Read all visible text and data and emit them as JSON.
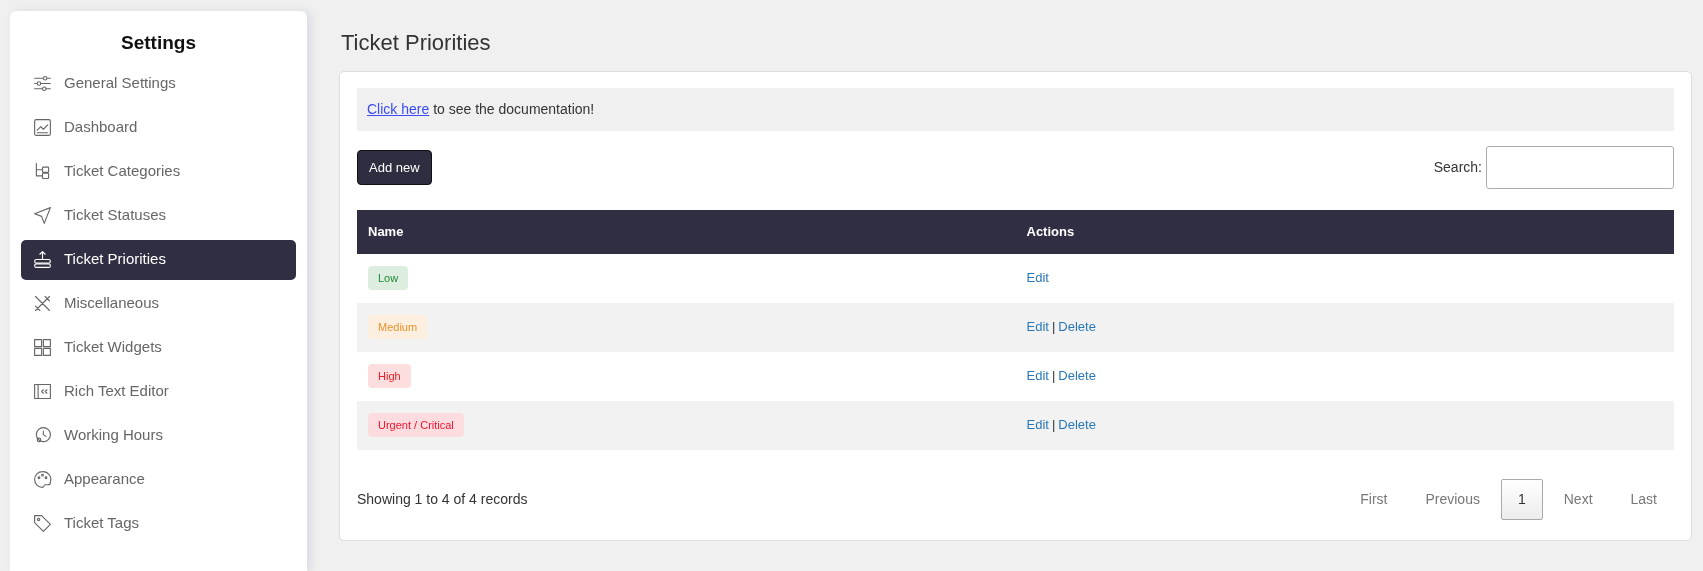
{
  "sidebar": {
    "title": "Settings",
    "items": [
      {
        "label": "General Settings",
        "selected": false
      },
      {
        "label": "Dashboard",
        "selected": false
      },
      {
        "label": "Ticket Categories",
        "selected": false
      },
      {
        "label": "Ticket Statuses",
        "selected": false
      },
      {
        "label": "Ticket Priorities",
        "selected": true
      },
      {
        "label": "Miscellaneous",
        "selected": false
      },
      {
        "label": "Ticket Widgets",
        "selected": false
      },
      {
        "label": "Rich Text Editor",
        "selected": false
      },
      {
        "label": "Working Hours",
        "selected": false
      },
      {
        "label": "Appearance",
        "selected": false
      },
      {
        "label": "Ticket Tags",
        "selected": false
      }
    ]
  },
  "page_title": "Ticket Priorities",
  "notice": {
    "link": "Click here",
    "text": " to see the documentation!"
  },
  "add_button": "Add new",
  "search": {
    "label": "Search:"
  },
  "table": {
    "columns": [
      "Name",
      "Actions"
    ],
    "rows": [
      {
        "name": "Low",
        "color": "#1e8b34",
        "actions": [
          {
            "kind": "link",
            "label": "Edit"
          }
        ]
      },
      {
        "name": "Medium",
        "color": "#e8922c",
        "actions": [
          {
            "kind": "link",
            "label": "Edit"
          },
          {
            "kind": "separator",
            "label": "|"
          },
          {
            "kind": "link",
            "label": "Delete"
          }
        ]
      },
      {
        "name": "High",
        "color": "#e82127",
        "actions": [
          {
            "kind": "link",
            "label": "Edit"
          },
          {
            "kind": "separator",
            "label": "|"
          },
          {
            "kind": "link",
            "label": "Delete"
          }
        ]
      },
      {
        "name": "Urgent / Critical",
        "color": "#f0142e",
        "actions": [
          {
            "kind": "link",
            "label": "Edit"
          },
          {
            "kind": "separator",
            "label": "|"
          },
          {
            "kind": "link",
            "label": "Delete"
          }
        ]
      }
    ]
  },
  "footer": {
    "info": "Showing 1 to 4 of 4 records",
    "pages": [
      {
        "label": "First",
        "selected": false
      },
      {
        "label": "Previous",
        "selected": false
      },
      {
        "label": "1",
        "selected": true
      },
      {
        "label": "Next",
        "selected": false
      },
      {
        "label": "Last",
        "selected": false
      }
    ]
  }
}
